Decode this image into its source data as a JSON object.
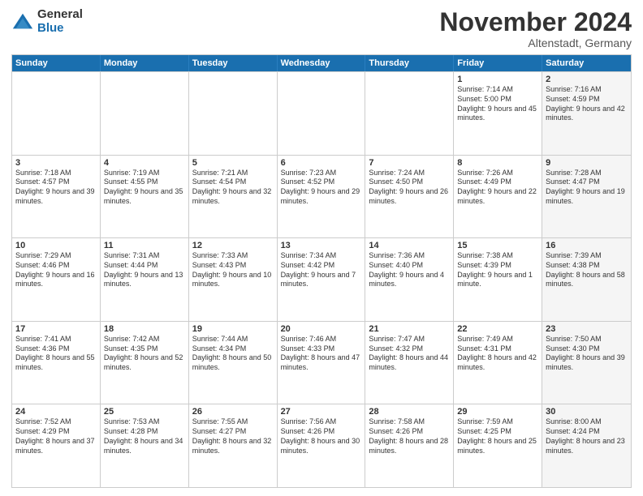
{
  "logo": {
    "general": "General",
    "blue": "Blue"
  },
  "header": {
    "month": "November 2024",
    "location": "Altenstadt, Germany"
  },
  "weekdays": [
    "Sunday",
    "Monday",
    "Tuesday",
    "Wednesday",
    "Thursday",
    "Friday",
    "Saturday"
  ],
  "rows": [
    [
      {
        "day": "",
        "text": "",
        "shaded": false,
        "empty": true
      },
      {
        "day": "",
        "text": "",
        "shaded": false,
        "empty": true
      },
      {
        "day": "",
        "text": "",
        "shaded": false,
        "empty": true
      },
      {
        "day": "",
        "text": "",
        "shaded": false,
        "empty": true
      },
      {
        "day": "",
        "text": "",
        "shaded": false,
        "empty": true
      },
      {
        "day": "1",
        "text": "Sunrise: 7:14 AM\nSunset: 5:00 PM\nDaylight: 9 hours and 45 minutes.",
        "shaded": false,
        "empty": false
      },
      {
        "day": "2",
        "text": "Sunrise: 7:16 AM\nSunset: 4:59 PM\nDaylight: 9 hours and 42 minutes.",
        "shaded": true,
        "empty": false
      }
    ],
    [
      {
        "day": "3",
        "text": "Sunrise: 7:18 AM\nSunset: 4:57 PM\nDaylight: 9 hours and 39 minutes.",
        "shaded": false,
        "empty": false
      },
      {
        "day": "4",
        "text": "Sunrise: 7:19 AM\nSunset: 4:55 PM\nDaylight: 9 hours and 35 minutes.",
        "shaded": false,
        "empty": false
      },
      {
        "day": "5",
        "text": "Sunrise: 7:21 AM\nSunset: 4:54 PM\nDaylight: 9 hours and 32 minutes.",
        "shaded": false,
        "empty": false
      },
      {
        "day": "6",
        "text": "Sunrise: 7:23 AM\nSunset: 4:52 PM\nDaylight: 9 hours and 29 minutes.",
        "shaded": false,
        "empty": false
      },
      {
        "day": "7",
        "text": "Sunrise: 7:24 AM\nSunset: 4:50 PM\nDaylight: 9 hours and 26 minutes.",
        "shaded": false,
        "empty": false
      },
      {
        "day": "8",
        "text": "Sunrise: 7:26 AM\nSunset: 4:49 PM\nDaylight: 9 hours and 22 minutes.",
        "shaded": false,
        "empty": false
      },
      {
        "day": "9",
        "text": "Sunrise: 7:28 AM\nSunset: 4:47 PM\nDaylight: 9 hours and 19 minutes.",
        "shaded": true,
        "empty": false
      }
    ],
    [
      {
        "day": "10",
        "text": "Sunrise: 7:29 AM\nSunset: 4:46 PM\nDaylight: 9 hours and 16 minutes.",
        "shaded": false,
        "empty": false
      },
      {
        "day": "11",
        "text": "Sunrise: 7:31 AM\nSunset: 4:44 PM\nDaylight: 9 hours and 13 minutes.",
        "shaded": false,
        "empty": false
      },
      {
        "day": "12",
        "text": "Sunrise: 7:33 AM\nSunset: 4:43 PM\nDaylight: 9 hours and 10 minutes.",
        "shaded": false,
        "empty": false
      },
      {
        "day": "13",
        "text": "Sunrise: 7:34 AM\nSunset: 4:42 PM\nDaylight: 9 hours and 7 minutes.",
        "shaded": false,
        "empty": false
      },
      {
        "day": "14",
        "text": "Sunrise: 7:36 AM\nSunset: 4:40 PM\nDaylight: 9 hours and 4 minutes.",
        "shaded": false,
        "empty": false
      },
      {
        "day": "15",
        "text": "Sunrise: 7:38 AM\nSunset: 4:39 PM\nDaylight: 9 hours and 1 minute.",
        "shaded": false,
        "empty": false
      },
      {
        "day": "16",
        "text": "Sunrise: 7:39 AM\nSunset: 4:38 PM\nDaylight: 8 hours and 58 minutes.",
        "shaded": true,
        "empty": false
      }
    ],
    [
      {
        "day": "17",
        "text": "Sunrise: 7:41 AM\nSunset: 4:36 PM\nDaylight: 8 hours and 55 minutes.",
        "shaded": false,
        "empty": false
      },
      {
        "day": "18",
        "text": "Sunrise: 7:42 AM\nSunset: 4:35 PM\nDaylight: 8 hours and 52 minutes.",
        "shaded": false,
        "empty": false
      },
      {
        "day": "19",
        "text": "Sunrise: 7:44 AM\nSunset: 4:34 PM\nDaylight: 8 hours and 50 minutes.",
        "shaded": false,
        "empty": false
      },
      {
        "day": "20",
        "text": "Sunrise: 7:46 AM\nSunset: 4:33 PM\nDaylight: 8 hours and 47 minutes.",
        "shaded": false,
        "empty": false
      },
      {
        "day": "21",
        "text": "Sunrise: 7:47 AM\nSunset: 4:32 PM\nDaylight: 8 hours and 44 minutes.",
        "shaded": false,
        "empty": false
      },
      {
        "day": "22",
        "text": "Sunrise: 7:49 AM\nSunset: 4:31 PM\nDaylight: 8 hours and 42 minutes.",
        "shaded": false,
        "empty": false
      },
      {
        "day": "23",
        "text": "Sunrise: 7:50 AM\nSunset: 4:30 PM\nDaylight: 8 hours and 39 minutes.",
        "shaded": true,
        "empty": false
      }
    ],
    [
      {
        "day": "24",
        "text": "Sunrise: 7:52 AM\nSunset: 4:29 PM\nDaylight: 8 hours and 37 minutes.",
        "shaded": false,
        "empty": false
      },
      {
        "day": "25",
        "text": "Sunrise: 7:53 AM\nSunset: 4:28 PM\nDaylight: 8 hours and 34 minutes.",
        "shaded": false,
        "empty": false
      },
      {
        "day": "26",
        "text": "Sunrise: 7:55 AM\nSunset: 4:27 PM\nDaylight: 8 hours and 32 minutes.",
        "shaded": false,
        "empty": false
      },
      {
        "day": "27",
        "text": "Sunrise: 7:56 AM\nSunset: 4:26 PM\nDaylight: 8 hours and 30 minutes.",
        "shaded": false,
        "empty": false
      },
      {
        "day": "28",
        "text": "Sunrise: 7:58 AM\nSunset: 4:26 PM\nDaylight: 8 hours and 28 minutes.",
        "shaded": false,
        "empty": false
      },
      {
        "day": "29",
        "text": "Sunrise: 7:59 AM\nSunset: 4:25 PM\nDaylight: 8 hours and 25 minutes.",
        "shaded": false,
        "empty": false
      },
      {
        "day": "30",
        "text": "Sunrise: 8:00 AM\nSunset: 4:24 PM\nDaylight: 8 hours and 23 minutes.",
        "shaded": true,
        "empty": false
      }
    ]
  ]
}
